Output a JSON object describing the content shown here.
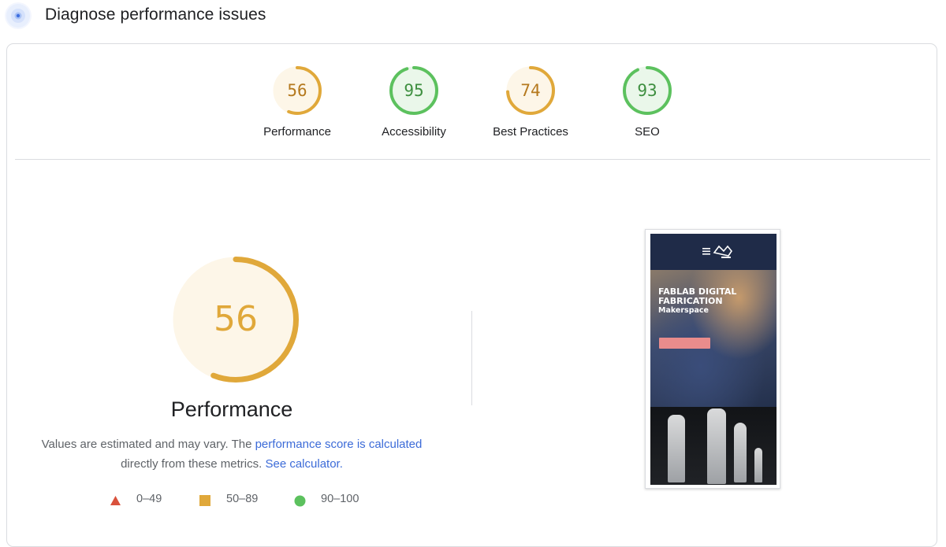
{
  "header": {
    "title": "Diagnose performance issues"
  },
  "colors": {
    "orange": "#e0a83a",
    "orange_bg": "#fdf6e8",
    "green": "#5cc15e",
    "green_bg": "#eaf7ea",
    "red": "#d9513c",
    "link": "#3c6bd8"
  },
  "categories": [
    {
      "label": "Performance",
      "score": "56",
      "value": 56,
      "tone": "orange"
    },
    {
      "label": "Accessibility",
      "score": "95",
      "value": 95,
      "tone": "green"
    },
    {
      "label": "Best Practices",
      "score": "74",
      "value": 74,
      "tone": "orange"
    },
    {
      "label": "SEO",
      "score": "93",
      "value": 93,
      "tone": "green"
    }
  ],
  "main": {
    "score": "56",
    "value": 56,
    "title": "Performance",
    "desc_text1": "Values are estimated and may vary. The ",
    "desc_link1": "performance score is calculated",
    "desc_text2": "directly from these metrics.",
    "desc_link2": "See calculator."
  },
  "legend": [
    {
      "range": "0–49",
      "icon": "triangle-icon"
    },
    {
      "range": "50–89",
      "icon": "square-icon"
    },
    {
      "range": "90–100",
      "icon": "circle-icon"
    }
  ],
  "screenshot": {
    "title_line1": "FABLAB DIGITAL",
    "title_line2": "FABRICATION",
    "subtitle": "Makerspace"
  }
}
